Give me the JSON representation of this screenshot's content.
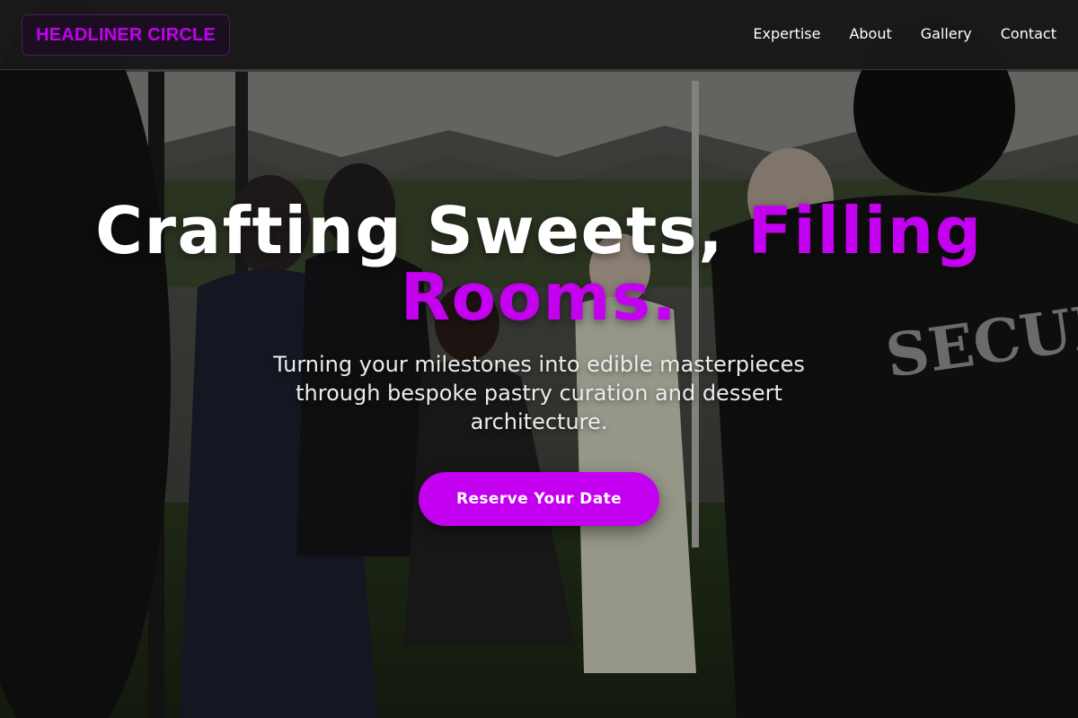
{
  "header": {
    "logo_text": "HEADLINER CIRCLE",
    "nav": [
      {
        "label": "Expertise"
      },
      {
        "label": "About"
      },
      {
        "label": "Gallery"
      },
      {
        "label": "Contact"
      }
    ]
  },
  "hero": {
    "title_part1": "Crafting Sweets, ",
    "title_accent": "Filling Rooms.",
    "subtitle": "Turning your milestones into edible masterpieces through bespoke pastry curation and dessert architecture.",
    "cta_label": "Reserve Your Date",
    "background_sign_text": "SECURITY"
  },
  "colors": {
    "accent": "#c400f0",
    "header_bg": "#181818",
    "text": "#ffffff"
  }
}
